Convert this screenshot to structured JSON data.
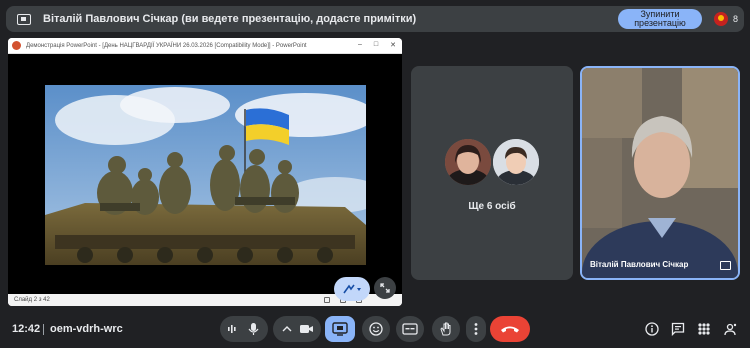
{
  "banner": {
    "text": "Віталій Павлович Січкар (ви ведете презентацію, додасте примітки)",
    "stop_button": "Зупинити презентацію",
    "participant_count": "8"
  },
  "presentation": {
    "window_title": "Демонстрація PowerPoint - [День НАЦГВАРДІЇ УКРАЇНИ 26.03.2026 [Compatibility Mode]] - PowerPoint",
    "slide_indicator": "Слайд 2 з 42"
  },
  "tiles": {
    "others_label": "Ще 6 осіб",
    "speaker_name": "Віталій Павлович Січкар"
  },
  "bottom_bar": {
    "time": "12:42",
    "meeting_code": "oem-vdrh-wrc"
  },
  "colors": {
    "background": "#202124",
    "surface": "#3c4043",
    "accent": "#8ab4f8",
    "hangup": "#ea4335"
  },
  "icons": [
    "present-icon",
    "audio-level-icon",
    "mic-icon",
    "chevron-up-icon",
    "camera-icon",
    "present-screen-icon",
    "emoji-icon",
    "captions-icon",
    "raise-hand-icon",
    "more-vert-icon",
    "hangup-icon",
    "info-icon",
    "chat-icon",
    "people-icon",
    "activities-icon"
  ]
}
